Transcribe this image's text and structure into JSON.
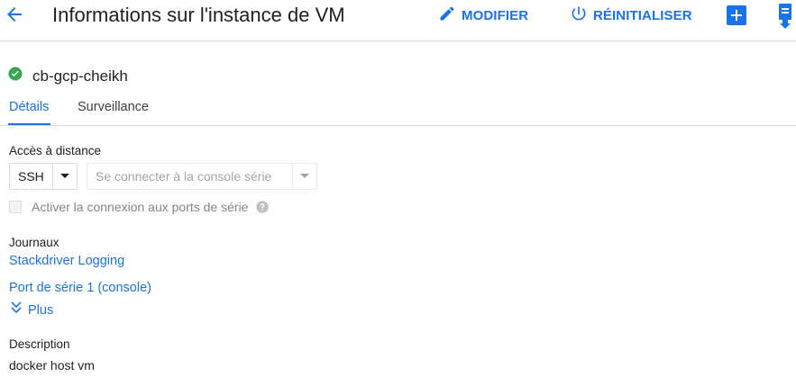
{
  "header": {
    "title": "Informations sur l'instance de VM",
    "back_icon": "arrow-back-icon",
    "actions": {
      "edit_label": "MODIFIER",
      "reset_label": "RÉINITIALISER"
    }
  },
  "instance": {
    "name": "cb-gcp-cheikh",
    "status_icon": "check-circle-icon",
    "status_color": "#34a853"
  },
  "tabs": [
    {
      "label": "Détails",
      "active": true
    },
    {
      "label": "Surveillance",
      "active": false
    }
  ],
  "remote_access": {
    "label": "Accès à distance",
    "ssh_label": "SSH",
    "serial_console_label": "Se connecter à la console série",
    "serial_checkbox_label": "Activer la connexion aux ports de série",
    "serial_checkbox_checked": false
  },
  "logs": {
    "label": "Journaux",
    "stackdriver_link": "Stackdriver Logging",
    "serial_port_link": "Port de série 1 (console)",
    "more_label": "Plus"
  },
  "description": {
    "label": "Description",
    "value": "docker host vm"
  },
  "colors": {
    "accent": "#1a73e8",
    "text": "#202124",
    "disabled_text": "#a0a4a8"
  }
}
